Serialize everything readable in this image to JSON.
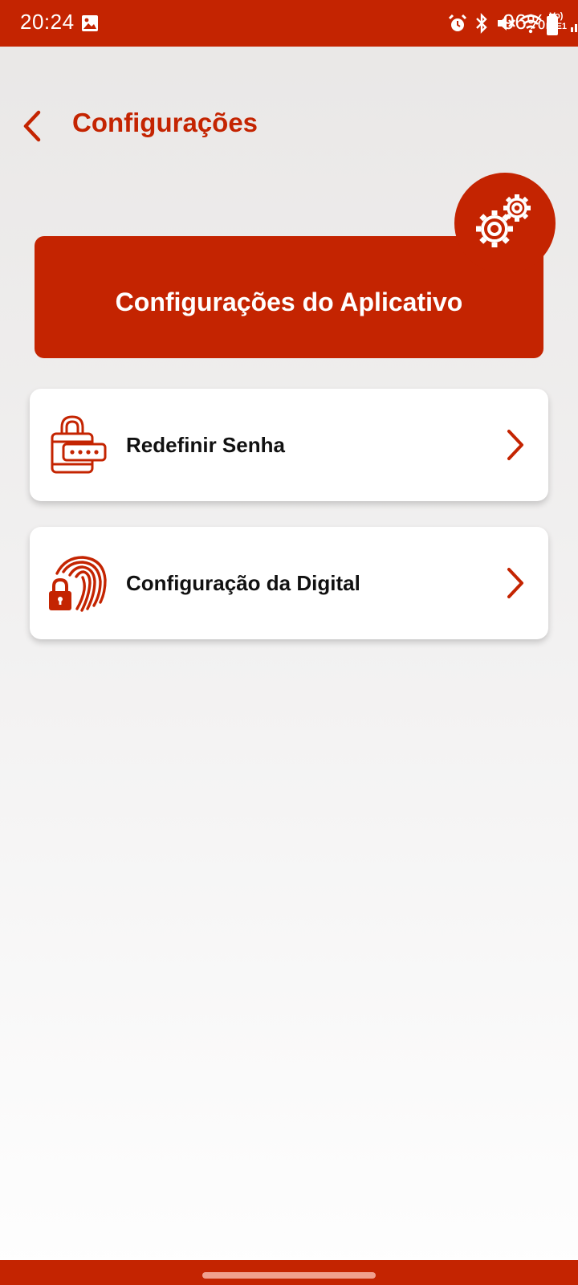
{
  "status_bar": {
    "time": "20:24",
    "battery_percent": "96%",
    "network_label": "Vo) LTE1",
    "icons": [
      "gallery-icon",
      "alarm-icon",
      "bluetooth-icon",
      "mute-icon",
      "wifi-icon",
      "volte-icon",
      "signal-icon",
      "battery-icon"
    ]
  },
  "header": {
    "back_icon": "chevron-left-icon",
    "title": "Configurações"
  },
  "banner": {
    "title": "Configurações do Aplicativo",
    "icon": "gears-icon"
  },
  "menu": {
    "items": [
      {
        "label": "Redefinir Senha",
        "icon": "padlock-password-icon"
      },
      {
        "label": "Configuração da Digital",
        "icon": "fingerprint-lock-icon"
      }
    ]
  },
  "colors": {
    "primary": "#c42401",
    "background_top": "#e9e7e6",
    "background_bottom": "#fefefe",
    "card": "#ffffff",
    "text": "#111111"
  }
}
